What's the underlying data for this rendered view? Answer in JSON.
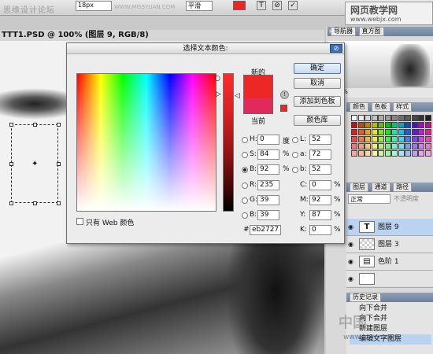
{
  "topbar": {
    "watermark": "思缘设计论坛",
    "font_size": "18px",
    "watermark_url": "WWW.MISSYUAN.COM",
    "antialias": "平滑"
  },
  "site_logo": {
    "line1": "网页教学网",
    "line2": "www.webjx.com"
  },
  "document": {
    "title": "TTT1.PSD @ 100% (图层 9, RGB/8)"
  },
  "navigator": {
    "tabs": [
      "导航器",
      "直方图"
    ],
    "zoom": "100%"
  },
  "swatches_panel": {
    "tabs": [
      "颜色",
      "色板",
      "样式"
    ]
  },
  "layers_panel": {
    "tabs": [
      "图层",
      "通道",
      "路径"
    ],
    "blend_mode": "正常",
    "opacity_label": "不透明度",
    "rows": [
      {
        "thumb": "T",
        "label": "图层 9",
        "selected": true
      },
      {
        "thumb": "",
        "label": "图层 3",
        "selected": false
      },
      {
        "thumb": "",
        "label": "色阶 1",
        "selected": false
      },
      {
        "thumb": "",
        "label": "",
        "selected": false
      }
    ]
  },
  "history_panel": {
    "title": "历史记录",
    "items": [
      "向下合并",
      "向下合并",
      "新建图层",
      "编辑文字图层"
    ]
  },
  "watermark_bottom": {
    "line1": "中国",
    "line2": "www.jcwcn.com"
  },
  "dialog": {
    "title": "选择文本颜色:",
    "new_label": "新的",
    "current_label": "当前",
    "new_color": "#eb2727",
    "current_color": "#e02a5c",
    "ok": "确定",
    "cancel": "取消",
    "add_swatch": "添加到色板",
    "color_library": "颜色库",
    "web_only": "只有 Web 颜色",
    "hsb": {
      "H": "0",
      "S": "84",
      "B": "92",
      "h_unit": "度",
      "s_unit": "%",
      "b_unit": "%"
    },
    "rgb": {
      "R": "235",
      "G": "39",
      "B": "39"
    },
    "lab": {
      "L": "52",
      "a": "72",
      "b": "52"
    },
    "cmyk": {
      "C": "0",
      "M": "92",
      "Y": "87",
      "K": "0",
      "unit": "%"
    },
    "hex": "eb2727"
  }
}
